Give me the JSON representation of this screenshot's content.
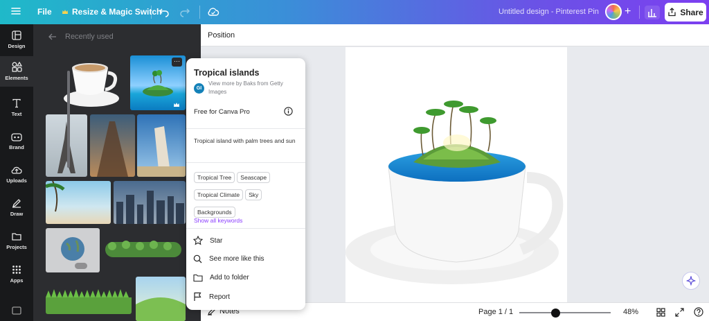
{
  "topbar": {
    "file_label": "File",
    "resize_label": "Resize & Magic Switch",
    "doc_title": "Untitled design - Pinterest Pin",
    "share_label": "Share",
    "plus_label": "+"
  },
  "rail": {
    "items": [
      {
        "label": "Design",
        "icon": "design-icon"
      },
      {
        "label": "Elements",
        "icon": "elements-icon"
      },
      {
        "label": "Text",
        "icon": "text-icon"
      },
      {
        "label": "Brand",
        "icon": "brand-icon"
      },
      {
        "label": "Uploads",
        "icon": "uploads-icon"
      },
      {
        "label": "Draw",
        "icon": "draw-icon"
      },
      {
        "label": "Projects",
        "icon": "projects-icon"
      },
      {
        "label": "Apps",
        "icon": "apps-icon"
      }
    ]
  },
  "panel": {
    "heading": "Recently used",
    "more_glyph": "···"
  },
  "main": {
    "position_label": "Position",
    "notes_label": "Notes",
    "page_label": "Page 1 / 1",
    "zoom_label": "48%",
    "zoom_level": 48
  },
  "popup": {
    "title": "Tropical islands",
    "avatar_text": "GI",
    "creator_text": "View more by Baks from Getty Images",
    "license_text": "Free for Canva Pro",
    "description": "Tropical island with palm trees and sun",
    "keywords": [
      "Tropical Tree",
      "Seascape",
      "Tropical Climate",
      "Sky",
      "Backgrounds"
    ],
    "show_keywords_label": "Show all keywords",
    "actions": {
      "star": "Star",
      "see_more": "See more like this",
      "add_folder": "Add to folder",
      "report": "Report"
    }
  },
  "colors": {
    "accent": "#7d2ae8",
    "rail_bg": "#18191b",
    "panel_bg": "#2c2d30",
    "link": "#8b3dff"
  }
}
